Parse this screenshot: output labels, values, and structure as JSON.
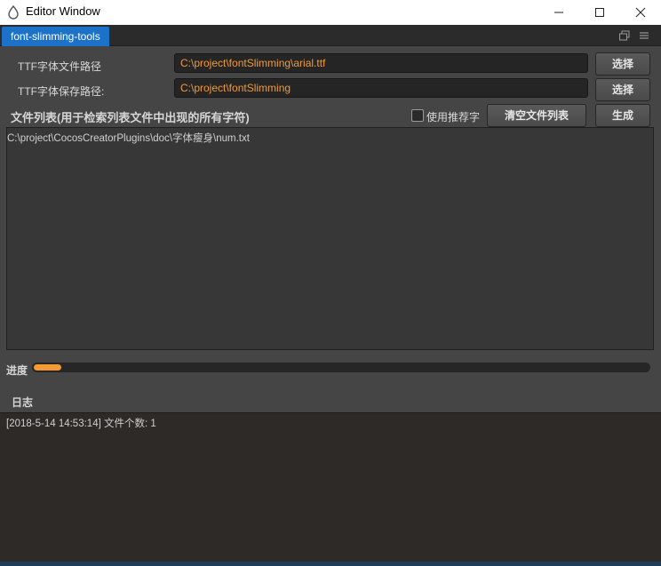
{
  "window": {
    "title": "Editor Window",
    "controls": {
      "minimize_icon": "minimize-icon",
      "maximize_icon": "maximize-icon",
      "close_icon": "close-icon"
    }
  },
  "tab": {
    "label": "font-slimming-tools"
  },
  "ttf_path": {
    "label": "TTF字体文件路径",
    "value": "C:\\project\\fontSlimming\\arial.ttf",
    "button": "选择"
  },
  "save_path": {
    "label": "TTF字体保存路径:",
    "value": "C:\\project\\fontSlimming",
    "button": "选择"
  },
  "file_list": {
    "title": "文件列表(用于检索列表文件中出现的所有字符)",
    "use_recommended_label": "使用推荐字",
    "use_recommended_checked": false,
    "clear_button": "清空文件列表",
    "generate_button": "生成",
    "items": [
      "C:\\project\\CocosCreatorPlugins\\doc\\字体瘦身\\num.txt"
    ]
  },
  "progress": {
    "label": "进度",
    "fraction": 0.045
  },
  "log": {
    "title": "日志",
    "lines": [
      "[2018-5-14 14:53:14] 文件个数: 1"
    ]
  },
  "colors": {
    "accent": "#f39a36",
    "tab": "#1c72c9",
    "panel": "#454545",
    "log_bg": "#2e2a27"
  }
}
